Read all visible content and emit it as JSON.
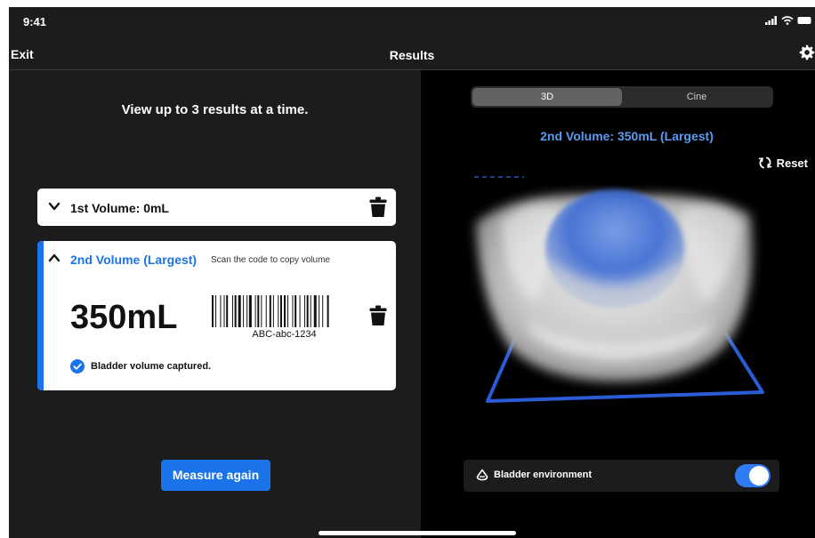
{
  "status_bar": {
    "time": "9:41"
  },
  "nav": {
    "exit_label": "Exit",
    "title": "Results"
  },
  "left_panel": {
    "hint": "View up to 3 results at a time.",
    "volumes": [
      {
        "label": "1st Volume: 0mL",
        "expanded": false
      },
      {
        "label": "2nd Volume (Largest)",
        "subtitle": "Scan the code to copy volume",
        "volume": "350mL",
        "barcode_text": "ABC-abc-1234",
        "status": "Bladder volume captured.",
        "expanded": true
      }
    ],
    "measure_again_label": "Measure again"
  },
  "right_panel": {
    "segments": [
      {
        "label": "3D",
        "active": true
      },
      {
        "label": "Cine",
        "active": false
      }
    ],
    "volume_title": "2nd Volume: 350mL (Largest)",
    "reset_label": "Reset",
    "environment_label": "Bladder environment",
    "environment_on": true
  },
  "colors": {
    "accent": "#1a73e8",
    "highlight_text": "#5b9bf0",
    "toggle_on": "#2f7cf6"
  }
}
